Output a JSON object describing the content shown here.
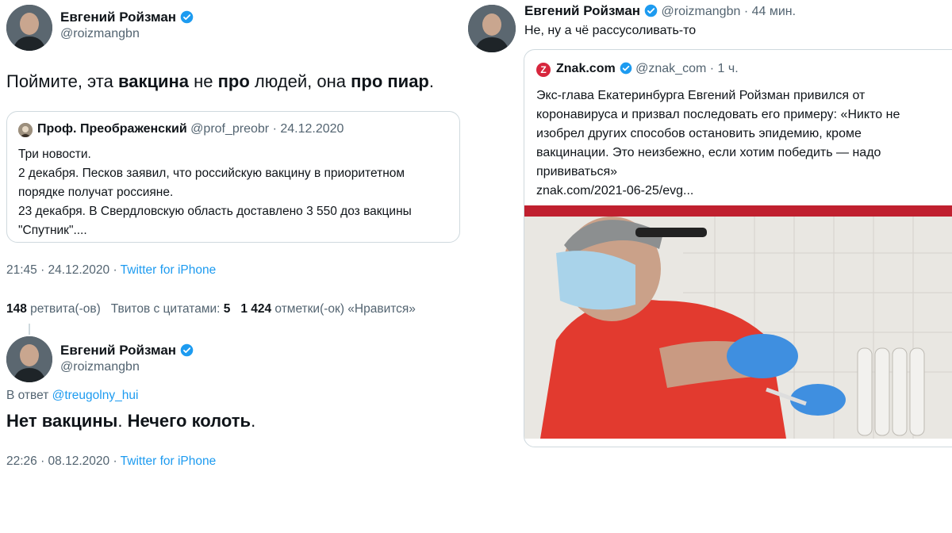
{
  "left": {
    "tweet1": {
      "name": "Евгений Ройзман",
      "handle": "@roizmangbn",
      "text": {
        "p1": "Поймите, эта ",
        "b1": "вакцина",
        "p2": " не ",
        "b2": "про",
        "p3": " людей, она ",
        "b3": "про пиар",
        "p4": "."
      },
      "quote": {
        "name": "Проф. Преображенский",
        "handle": "@prof_preobr",
        "date": "· 24.12.2020",
        "lines": [
          "Три новости.",
          "2 декабря. Песков заявил, что российскую вакцину в приоритетном",
          "порядке получат россияне.",
          "23 декабря. В Свердловскую область доставлено 3 550 доз вакцины",
          "\"Спутник\"...."
        ]
      },
      "time": "21:45 · 24.12.2020 · ",
      "source": "Twitter for iPhone",
      "stats": {
        "retweets_num": "148",
        "retweets_label": " ретвита(-ов)",
        "quotes_label": "Твитов с цитатами:",
        "quotes_num": "5",
        "likes_num": "1 424",
        "likes_label": " отметки(-ок) «Нравится»"
      }
    },
    "tweet2": {
      "name": "Евгений Ройзман",
      "handle": "@roizmangbn",
      "reply_prefix": "В ответ ",
      "reply_to": "@treugolny_hui",
      "text": {
        "b1": "Нет вакцины",
        "p1": ". ",
        "b2": "Нечего колоть",
        "p2": "."
      },
      "time": "22:26 · 08.12.2020 · ",
      "source": "Twitter for iPhone"
    }
  },
  "right": {
    "tweet": {
      "name": "Евгений Ройзман",
      "handle_time": "@roizmangbn · 44 мин.",
      "text": "Не, ну а чё рассусоливать-то",
      "quote": {
        "logo_letter": "Z",
        "name": "Znak.com",
        "handle_time": "@znak_com · 1 ч.",
        "lines": [
          "Экс-глава Екатеринбурга Евгений Ройзман привился от",
          "коронавируса и призвал последовать его примеру: «Никто не",
          "изобрел других способов остановить эпидемию, кроме",
          "вакцинации. Это неизбежно, если хотим победить — надо",
          "прививаться»"
        ],
        "url": "znak.com/2021-06-25/evg..."
      }
    }
  },
  "colors": {
    "accent": "#1d9bf0",
    "muted": "#536471",
    "border": "#cfd9de",
    "znak_red": "#d7263d"
  },
  "icons": [
    "verified-badge-icon",
    "znak-logo-icon",
    "avatar-photo"
  ]
}
